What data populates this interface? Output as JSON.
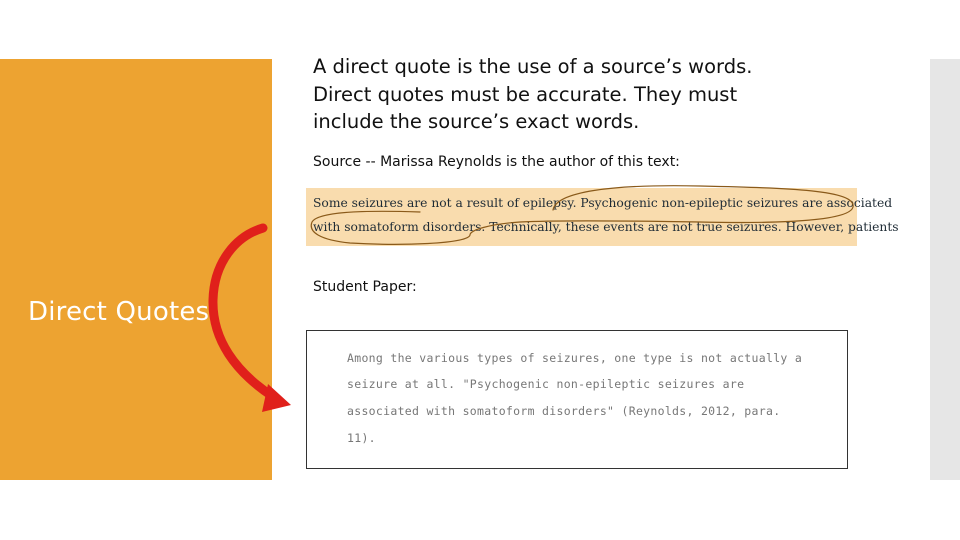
{
  "slide": {
    "section_title": "Direct Quotes",
    "intro_lines": [
      "A direct quote is the use of a source’s words.",
      "Direct quotes must be accurate. They must",
      "include the source’s exact words."
    ],
    "source_label": "Source -- Marissa Reynolds is the author of this text:",
    "source_text": {
      "line1": "Some seizures are not a result of epilepsy. Psychogenic non-epileptic seizures are associated",
      "line2": "with somatoform disorders. Technically, these events are not true seizures. However, patients"
    },
    "student_label": "Student Paper:",
    "student_paper_lines": [
      "Among the various types of seizures, one type is not actually a",
      "seizure at all. \"Psychogenic non-epileptic seizures are",
      "associated with somatoform disorders\" (Reynolds, 2012, para.",
      "11)."
    ]
  },
  "colors": {
    "accent_orange": "#eda331",
    "source_highlight": "#f9dcae",
    "arrow_red": "#e0201b",
    "side_bar_gray": "#e6e6e6",
    "circle_ink": "#8a5a1a"
  },
  "icons": {
    "arrow": "curved-red-arrow-icon"
  }
}
